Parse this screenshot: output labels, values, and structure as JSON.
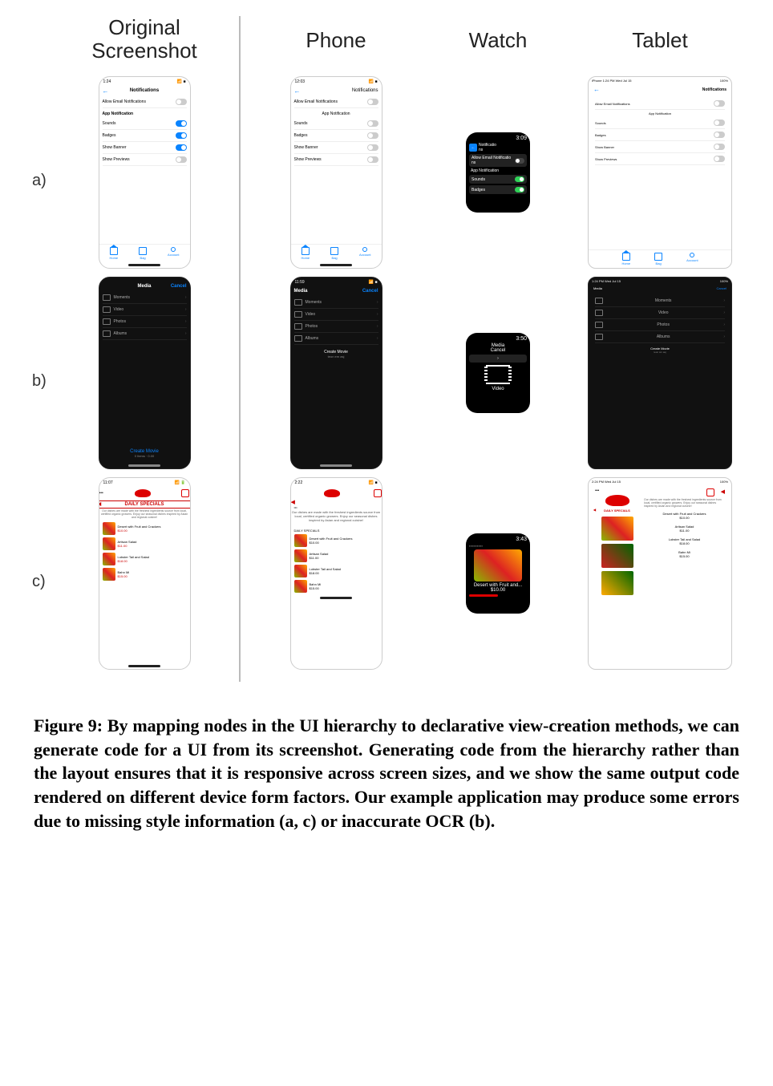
{
  "columns": {
    "original": "Original\nScreenshot",
    "phone": "Phone",
    "watch": "Watch",
    "tablet": "Tablet"
  },
  "row_labels": {
    "a": "a)",
    "b": "b)",
    "c": "c)"
  },
  "notifications": {
    "time_original": "1:24",
    "time_phone": "12:03",
    "time_watch": "3:09",
    "tablet_status_left": "iPhone 1:24 PM  Wed Jul 15",
    "tablet_status_right": "100%",
    "title": "Notifications",
    "title_watch_wrapped": "Notificatio\nns",
    "allow_email": "Allow Email Notifications",
    "allow_email_watch": "Allow Email Notificatio\nns",
    "section": "App Notification",
    "items": {
      "sounds": "Sounds",
      "badges": "Badges",
      "show_banner": "Show Banner",
      "show_previews": "Show Previews"
    },
    "tabs": {
      "home": "Home",
      "bag": "Bag",
      "account": "Account"
    }
  },
  "media": {
    "time_original": "",
    "time_phone": "11:59",
    "time_watch": "3:50",
    "tablet_status_left": "1:24 PM  Wed Jul 15",
    "title": "Media",
    "cancel": "Cancel",
    "items": {
      "moments": "Moments",
      "video": "Video",
      "photos": "Photos",
      "albums": "Albums"
    },
    "create_movie": "Create Movie",
    "create_movie_sub_orig": "0 Items · 0.00",
    "create_movie_sub_phone": "teon em asj",
    "create_movie_sub_tablet": "teon sm asj"
  },
  "specials": {
    "time_original": "11:07",
    "time_phone": "2:22",
    "time_watch": "3:43",
    "tablet_status_left": "2:24 PM  Wed Jul 15",
    "dots": "•••",
    "title": "DAILY SPECIALS",
    "watch_header": "",
    "blurb_original": "Our dishes are made with the freshest ingredients source from local, certified organic growers. Enjoy our seasonal dishes inspired by Asian and regional cuisine!",
    "blurb_phone": "Our dishes are made with the freshest ingredients source from local, certified organic growers. Enjoy our seasonal dishes inspired by Asian and regional cuisine!",
    "blurb_tablet": "Our dishes are made with the freshest ingredients source from local, certified organic growers. Enjoy our seasonal dishes inspired by Asian and regional cuisine!",
    "items": [
      {
        "name": "Desert with Fruit and Crackers",
        "price_original": "$10.00",
        "price_gen": "$10.00"
      },
      {
        "name": "Artisan Salad",
        "price_original": "$11.00",
        "price_gen": "$11.00"
      },
      {
        "name": "Lobster Tail and Salad",
        "price_original": "$18.00",
        "price_gen": "$18.00"
      },
      {
        "name": "Bahn Mi",
        "price_original": "$15.00",
        "price_gen": "$15.00"
      }
    ],
    "watch_item_name": "Desert with Fruit and...",
    "watch_item_price": "$10.00"
  },
  "caption": "Figure 9: By mapping nodes in the UI hierarchy to declarative view-creation methods, we can generate code for a UI from its screenshot. Generating code from the hierarchy rather than the layout ensures that it is responsive across screen sizes, and we show the same output code rendered on different device form factors. Our example application may produce some errors due to missing style information (a, c) or inaccurate OCR (b)."
}
